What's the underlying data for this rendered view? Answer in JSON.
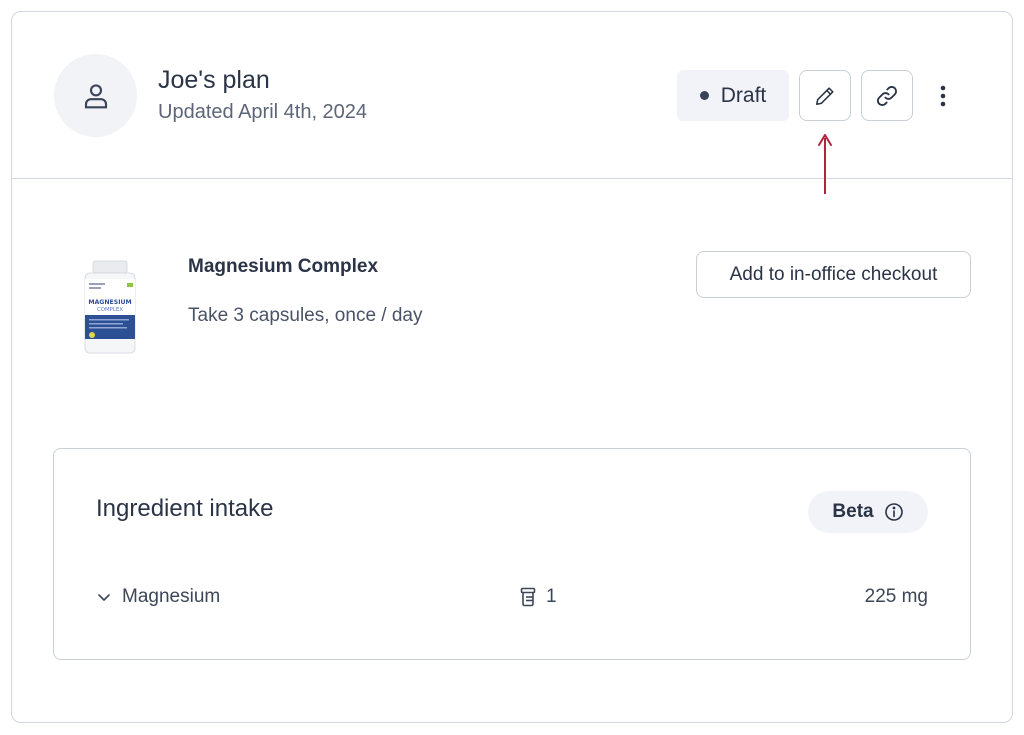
{
  "plan": {
    "title": "Joe's plan",
    "updated": "Updated April 4th, 2024",
    "status": "Draft"
  },
  "icons": {
    "avatar": "user-icon",
    "edit": "pencil-icon",
    "link": "link-icon",
    "more": "more-vertical-icon",
    "info": "info-icon",
    "chevron": "chevron-down-icon",
    "bottle": "pill-bottle-icon"
  },
  "product": {
    "name": "Magnesium Complex",
    "dosage": "Take 3 capsules, once / day",
    "image_label_top": "MAGNESIUM",
    "image_label_bottom": "COMPLEX",
    "checkout_label": "Add to in-office checkout"
  },
  "intake": {
    "title": "Ingredient intake",
    "badge": "Beta",
    "ingredients": [
      {
        "name": "Magnesium",
        "count": "1",
        "amount": "225 mg"
      }
    ]
  },
  "colors": {
    "border": "#d3d7e1",
    "text": "#2b3447",
    "badge_bg": "#f1f3f8",
    "arrow": "#b0243c",
    "product_blue": "#2d4f93"
  }
}
